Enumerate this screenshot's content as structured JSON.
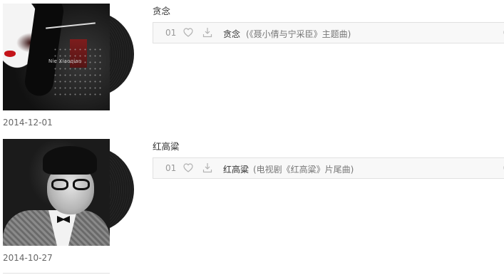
{
  "albums": [
    {
      "title": "贪念",
      "date": "2014-12-01",
      "cover_text": "Nie Xiaoqian",
      "track": {
        "number": "01",
        "name": "贪念",
        "subtitle": "(《聂小倩与宁采臣》主题曲)"
      }
    },
    {
      "title": "红高粱",
      "date": "2014-10-27",
      "track": {
        "number": "01",
        "name": "红高粱",
        "subtitle": "(电视剧《红高粱》片尾曲)"
      }
    }
  ],
  "icons": {
    "like": "heart-icon",
    "download": "download-icon",
    "more": "clock-icon"
  },
  "colors": {
    "row_background": "#f8f8f8",
    "row_border": "#e1e1e1",
    "icon": "#b3b3b3"
  }
}
